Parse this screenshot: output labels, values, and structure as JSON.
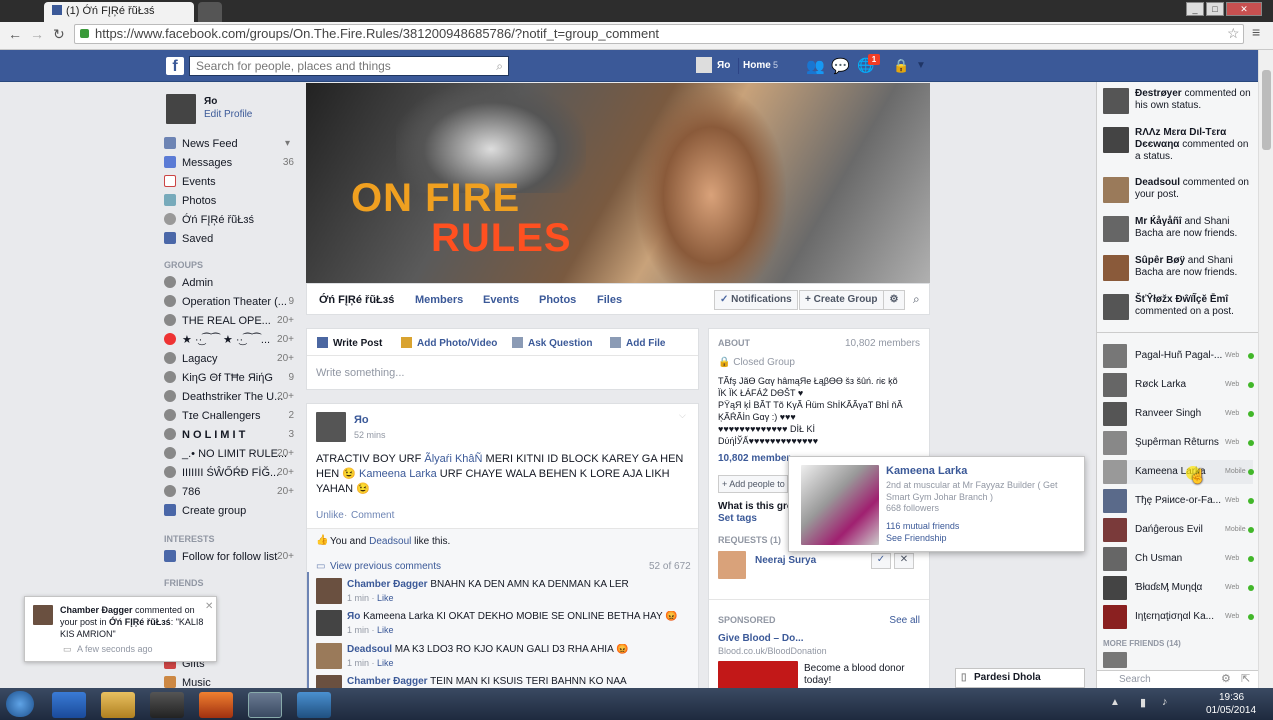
{
  "browser": {
    "tab_title": "(1) Ớń FĮŖé řũŁɜś",
    "url": "https://www.facebook.com/groups/On.The.Fire.Rules/381200948685786/?notif_t=group_comment"
  },
  "fb_bar": {
    "search_placeholder": "Search for people, places and things",
    "user_name": "Яo",
    "home_label": "Home",
    "home_count": "5",
    "notif_count": "1"
  },
  "left": {
    "profile_name": "Яo",
    "edit_profile": "Edit Profile",
    "favorites": [
      {
        "label": "News Feed",
        "count": ""
      },
      {
        "label": "Messages",
        "count": "36"
      },
      {
        "label": "Events",
        "count": ""
      },
      {
        "label": "Photos",
        "count": ""
      },
      {
        "label": "Ớń FĮŖé řũŁɜś",
        "count": ""
      },
      {
        "label": "Saved",
        "count": ""
      }
    ],
    "groups_heading": "GROUPS",
    "groups": [
      {
        "label": "Admin",
        "count": ""
      },
      {
        "label": "Operation Theater (...",
        "count": "9"
      },
      {
        "label": "THE REAL OPE...",
        "count": "20+"
      },
      {
        "label": "★ ·͜·⁀⁀ ★ ·͜·⁀⁀...",
        "count": "20+"
      },
      {
        "label": "Lagacy",
        "count": "20+"
      },
      {
        "label": "KiηG Θf TĦe ЯiήG",
        "count": "9"
      },
      {
        "label": "Deathstriker The U...",
        "count": "20+"
      },
      {
        "label": "Tɪe Cнallengers",
        "count": "2"
      },
      {
        "label": "N O L I M I T",
        "count": "3"
      },
      {
        "label": "_.• NO LIMIT RULE...",
        "count": "20+"
      },
      {
        "label": "IIIIIII ŚŴŐŔĐ FİĞ...",
        "count": "20+"
      },
      {
        "label": "786",
        "count": "20+"
      },
      {
        "label": "Create group",
        "count": ""
      }
    ],
    "interests_heading": "INTERESTS",
    "interests": [
      {
        "label": "Follow for follow list",
        "count": "20+"
      }
    ],
    "friends_heading": "FRIENDS",
    "more": [
      {
        "label": "Gifts"
      },
      {
        "label": "Music"
      }
    ]
  },
  "cover": {
    "line1": "ON FIRE",
    "line2": "RULES"
  },
  "group_nav": {
    "name": "Ớń FĮŖé řũŁɜś",
    "tabs": [
      "Members",
      "Events",
      "Photos",
      "Files"
    ],
    "notifications": "Notifications",
    "create_group": "Create Group"
  },
  "composer": {
    "tabs": [
      "Write Post",
      "Add Photo/Video",
      "Ask Question",
      "Add File"
    ],
    "placeholder": "Write something..."
  },
  "post": {
    "author": "Яo",
    "time": "52 mins",
    "text_a": "ATRACTIV BOY URF ",
    "tag1": "Ãlyaŕi KhâÑ",
    "text_b": " MERI KITNI ID BLOCK KAREY GA HEN HEN 😉 ",
    "tag2": "Kameena Larka",
    "text_c": " URF CHAYE WALA BEHEN K LORE AJA LIKH YAHAN 😉",
    "unlike": "Unlike",
    "comment": "Comment",
    "likes_a": "You and ",
    "likes_name": "Deadsoul",
    "likes_b": " like this.",
    "view_prev": "View previous comments",
    "count": "52 of 672",
    "comments": [
      {
        "name": "Chamber Ðagger",
        "text": " BNAHN KA DEN AMN KA DENMAN KA LER",
        "time": "1 min",
        "like": "Like"
      },
      {
        "name": "Яo",
        "text": " Kameena Larka KI OKAT DEKHO MOBIE SE ONLINE BETHA HAY 😡",
        "time": "1 min",
        "like": "Like"
      },
      {
        "name": "Deadsoul",
        "text": " MA K3 LDO3 RO KJO KAUN GALI D3 RHA AHIA 😡",
        "time": "1 min",
        "like": "Like"
      },
      {
        "name": "Chamber Ðagger",
        "text": " TEIN MAN KI KSUIS TERI BAHNN KO NAA",
        "time": "",
        "like": ""
      }
    ]
  },
  "about": {
    "heading": "ABOUT",
    "members": "10,802 members",
    "closed": "Closed Group",
    "desc1": "TÃfş JãƟ Gαγ hâmąЯe ŁąβƟƟ šз šûń. ɾiє ķõ",
    "desc2": "ÏK ÏK ŁÁFÁŹ DƟŠT ♥",
    "desc3": "PŸąЯ ķİ BÃT Tõ KγÃ Ĥüm ShİKÃÃγaT Bhİ ňÃ",
    "desc4": "ĶÃŔÃİn Gαγ :) ♥♥♥",
    "desc5": "♥♥♥♥♥♥♥♥♥♥♥♥♥ DİŁ Kİ",
    "desc6": "DύήİЎẤ♥♥♥♥♥♥♥♥♥♥♥♥♥",
    "members2": "10,802 member",
    "add_people": "+ Add people to G",
    "what_is": "What is this gro",
    "set_tags": "Set tags",
    "requests": "REQUESTS (1)",
    "request_name": "Neeraj Surya",
    "sponsored": "SPONSORED ",
    "see_all": "See all",
    "ad_title": "Give Blood – Do...",
    "ad_url": "Blood.co.uk/BloodDonation",
    "ad_text1": "Become a blood donor",
    "ad_text2": "today!"
  },
  "hover_card": {
    "name": "Kameena Larka",
    "detail": "2nd at muscular at Mr Fayyaz Builder ( Get Smart Gym Johar Branch )",
    "followers": "668 followers",
    "mutual": "116 mutual friends",
    "friendship": "See Friendship"
  },
  "ticker": [
    {
      "name": "Ðestrøyer",
      "rest": " commented on his own status."
    },
    {
      "name": "RΛΛz Mεrα Dιl-Tεrα Dєєwαηα",
      "rest": " commented on a status."
    },
    {
      "name": "Deadsoul",
      "rest": " commented on your post."
    },
    {
      "name": "Mr Ќåγåñî",
      "rest": " and Shani Bacha are now friends."
    },
    {
      "name": "Sûpêr Bøÿ",
      "rest": " and Shani Bacha are now friends."
    },
    {
      "name": "ŠťŶłøžx ĐŵïĨçĕ Ēmî",
      "rest": " commented on a post."
    }
  ],
  "chat": [
    {
      "name": "Pagal-Huñ Pagal-...",
      "status": "Web"
    },
    {
      "name": "Røck Larka",
      "status": "Web"
    },
    {
      "name": "Ranveer Singh",
      "status": "Web"
    },
    {
      "name": "Şupêrman Rêturns",
      "status": "Web"
    },
    {
      "name": "Kameena Larka",
      "status": "Mobile"
    },
    {
      "name": "Tђę Pяiиce-or-Fa...",
      "status": "Web"
    },
    {
      "name": "Dańĝerous Evil",
      "status": "Mobile"
    },
    {
      "name": "Ch Usman",
      "status": "Web"
    },
    {
      "name": "ƁłɑɗɛӍ Mυηɖα",
      "status": "Web"
    },
    {
      "name": "Iηţєrηαţiσηαl Ka...",
      "status": "Web"
    }
  ],
  "chat_more": "MORE FRIENDS (14)",
  "chat_search": "Search",
  "notification": {
    "name": "Chamber Ðagger",
    "text1": " commented",
    "text2": "on your post in ",
    "group": "Ớń FĮŖé řũŁɜś",
    "text3": ": \"KALI8 KIS AMRION\"",
    "time": "A few seconds ago"
  },
  "chat_tab": "Pardesi Dhola",
  "clock": {
    "time": "19:36",
    "date": "01/05/2014"
  },
  "colors": {
    "fb_blue": "#3b5998",
    "online": "#42b72a"
  }
}
